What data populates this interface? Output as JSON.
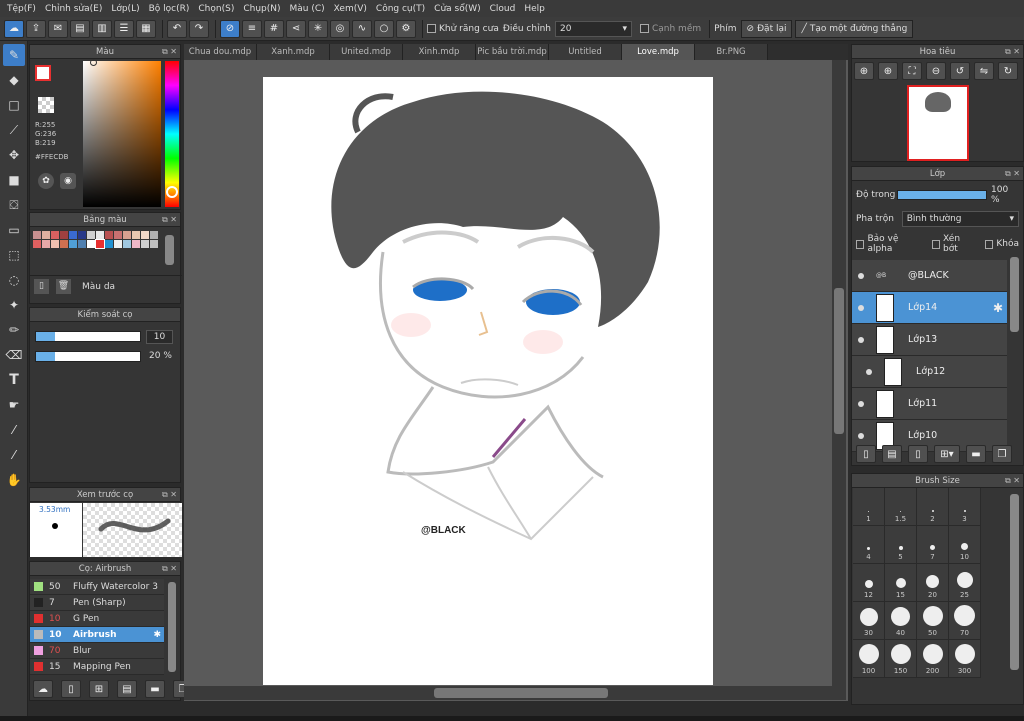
{
  "menu": [
    "Tệp(F)",
    "Chỉnh sửa(E)",
    "Lớp(L)",
    "Bộ lọc(R)",
    "Chọn(S)",
    "Chụp(N)",
    "Màu (C)",
    "Xem(V)",
    "Công cụ(T)",
    "Cửa sổ(W)",
    "Cloud",
    "Help"
  ],
  "toolbar": {
    "antialias": "Khử răng cưa",
    "adjust_label": "Điều chỉnh",
    "adjust_value": "20",
    "edge_label": "Cạnh mềm",
    "key_label": "Phím",
    "reset": "Đặt lại",
    "straight": "Tạo một đường thẳng"
  },
  "color_panel": {
    "title": "Màu",
    "r": "R:255",
    "g": "G:236",
    "b": "B:219",
    "hex": "#FFECDB"
  },
  "palette": {
    "title": "Bảng màu",
    "name": "Màu da",
    "colors": [
      "#c89090",
      "#e0b0a0",
      "#d86060",
      "#a04040",
      "#3a6ad0",
      "#283888",
      "#d0d0d0",
      "#e8e8e8",
      "#b85050",
      "#c87070",
      "#d8a090",
      "#e8c8b0",
      "#f0d8c8",
      "#b0b0b0",
      "#e06060",
      "#e8a8a8",
      "#f0c0b0",
      "#d07050",
      "#50a0d8",
      "#5080b0",
      "#ffffff",
      "#e83030",
      "#2090d0",
      "#f0f0f0",
      "#a0c8e0",
      "#f0b8c8",
      "#d0d0d0",
      "#c0c0c0"
    ]
  },
  "brush_control": {
    "title": "Kiểm soát cọ",
    "size": "10",
    "opacity": "20 %"
  },
  "brush_preview": {
    "title": "Xem trước cọ",
    "size": "3.53mm"
  },
  "brush_list": {
    "title": "Cọ: Airbrush",
    "items": [
      {
        "size": "50",
        "name": "Fluffy Watercolor 3",
        "color": "#a0e080"
      },
      {
        "size": "7",
        "name": "Pen (Sharp)",
        "color": "#222222"
      },
      {
        "size": "10",
        "name": "G Pen",
        "color": "#e03030"
      },
      {
        "size": "10",
        "name": "Airbrush",
        "color": "#bbbbbb"
      },
      {
        "size": "70",
        "name": "Blur",
        "color": "#f0a0e0"
      },
      {
        "size": "15",
        "name": "Mapping Pen",
        "color": "#e03030"
      }
    ]
  },
  "tabs": [
    "Chua dou.mdp",
    "Xanh.mdp",
    "United.mdp",
    "Xinh.mdp",
    "Pic bầu trời.mdp",
    "Untitled",
    "Love.mdp",
    "Br.PNG"
  ],
  "canvas": {
    "signature": "@BLACK"
  },
  "navigator": {
    "title": "Hoa tiêu"
  },
  "layers": {
    "title": "Lớp",
    "opacity_label": "Độ trong",
    "opacity_value": "100 %",
    "blend_label": "Pha trộn",
    "blend_value": "Bình thường",
    "protect_alpha": "Bảo vệ alpha",
    "clipping": "Xén bớt",
    "lock": "Khóa",
    "items": [
      "@BLACK",
      "Lớp14",
      "Lớp13",
      "Lớp12",
      "Lớp11",
      "Lớp10"
    ]
  },
  "brush_size": {
    "title": "Brush Size",
    "sizes": [
      "1",
      "1.5",
      "2",
      "3",
      "4",
      "5",
      "7",
      "10",
      "12",
      "15",
      "20",
      "25",
      "30",
      "40",
      "50",
      "70",
      "100",
      "150",
      "200",
      "300"
    ]
  }
}
